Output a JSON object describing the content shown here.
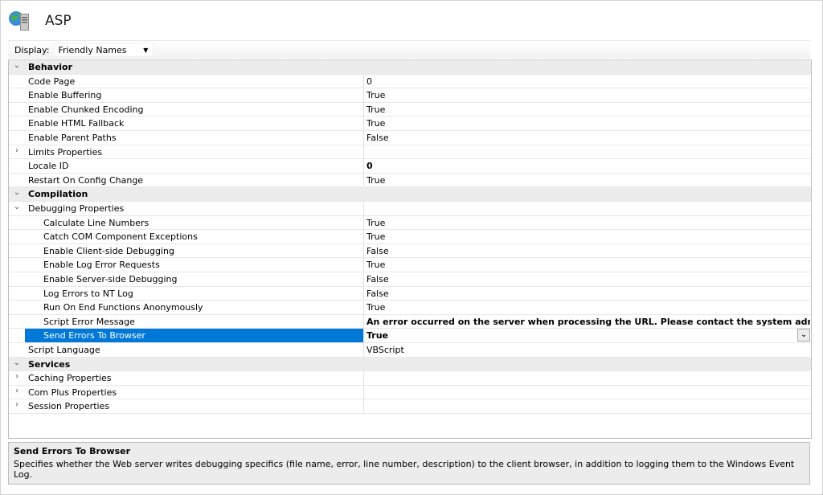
{
  "app": {
    "title": "ASP"
  },
  "toolbar": {
    "display_label": "Display:",
    "display_value": "Friendly Names"
  },
  "rows": [
    {
      "type": "category",
      "toggle": "⌄",
      "name": "Behavior",
      "value": ""
    },
    {
      "type": "prop",
      "name": "Code Page",
      "value": "0"
    },
    {
      "type": "prop",
      "name": "Enable Buffering",
      "value": "True"
    },
    {
      "type": "prop",
      "name": "Enable Chunked Encoding",
      "value": "True"
    },
    {
      "type": "prop",
      "name": "Enable HTML Fallback",
      "value": "True"
    },
    {
      "type": "prop",
      "name": "Enable Parent Paths",
      "value": "False"
    },
    {
      "type": "group",
      "toggle": "›",
      "name": "Limits Properties",
      "value": ""
    },
    {
      "type": "prop",
      "name": "Locale ID",
      "value": "0",
      "bold": true
    },
    {
      "type": "prop",
      "name": "Restart On Config Change",
      "value": "True"
    },
    {
      "type": "category",
      "toggle": "⌄",
      "name": "Compilation",
      "value": ""
    },
    {
      "type": "group",
      "toggle": "⌄",
      "name": "Debugging Properties",
      "value": ""
    },
    {
      "type": "subprop",
      "name": "Calculate Line Numbers",
      "value": "True"
    },
    {
      "type": "subprop",
      "name": "Catch COM Component Exceptions",
      "value": "True"
    },
    {
      "type": "subprop",
      "name": "Enable Client-side Debugging",
      "value": "False"
    },
    {
      "type": "subprop",
      "name": "Enable Log Error Requests",
      "value": "True"
    },
    {
      "type": "subprop",
      "name": "Enable Server-side Debugging",
      "value": "False"
    },
    {
      "type": "subprop",
      "name": "Log Errors to NT Log",
      "value": "False"
    },
    {
      "type": "subprop",
      "name": "Run On End Functions Anonymously",
      "value": "True"
    },
    {
      "type": "subprop",
      "name": "Script Error Message",
      "value": "An error occurred on the server when processing the URL. Please contact the system administrator. <p/> If y",
      "bold": true
    },
    {
      "type": "subprop",
      "name": "Send Errors To Browser",
      "value": "True",
      "selected": true
    },
    {
      "type": "prop",
      "name": "Script Language",
      "value": "VBScript"
    },
    {
      "type": "category",
      "toggle": "⌄",
      "name": "Services",
      "value": ""
    },
    {
      "type": "group",
      "toggle": "›",
      "name": "Caching Properties",
      "value": ""
    },
    {
      "type": "group",
      "toggle": "›",
      "name": "Com Plus Properties",
      "value": ""
    },
    {
      "type": "group",
      "toggle": "›",
      "name": "Session Properties",
      "value": ""
    }
  ],
  "description": {
    "title": "Send Errors To Browser",
    "text": "Specifies whether the Web server writes debugging specifics (file name, error, line number, description) to the client browser, in addition to logging them to the Windows Event Log."
  }
}
